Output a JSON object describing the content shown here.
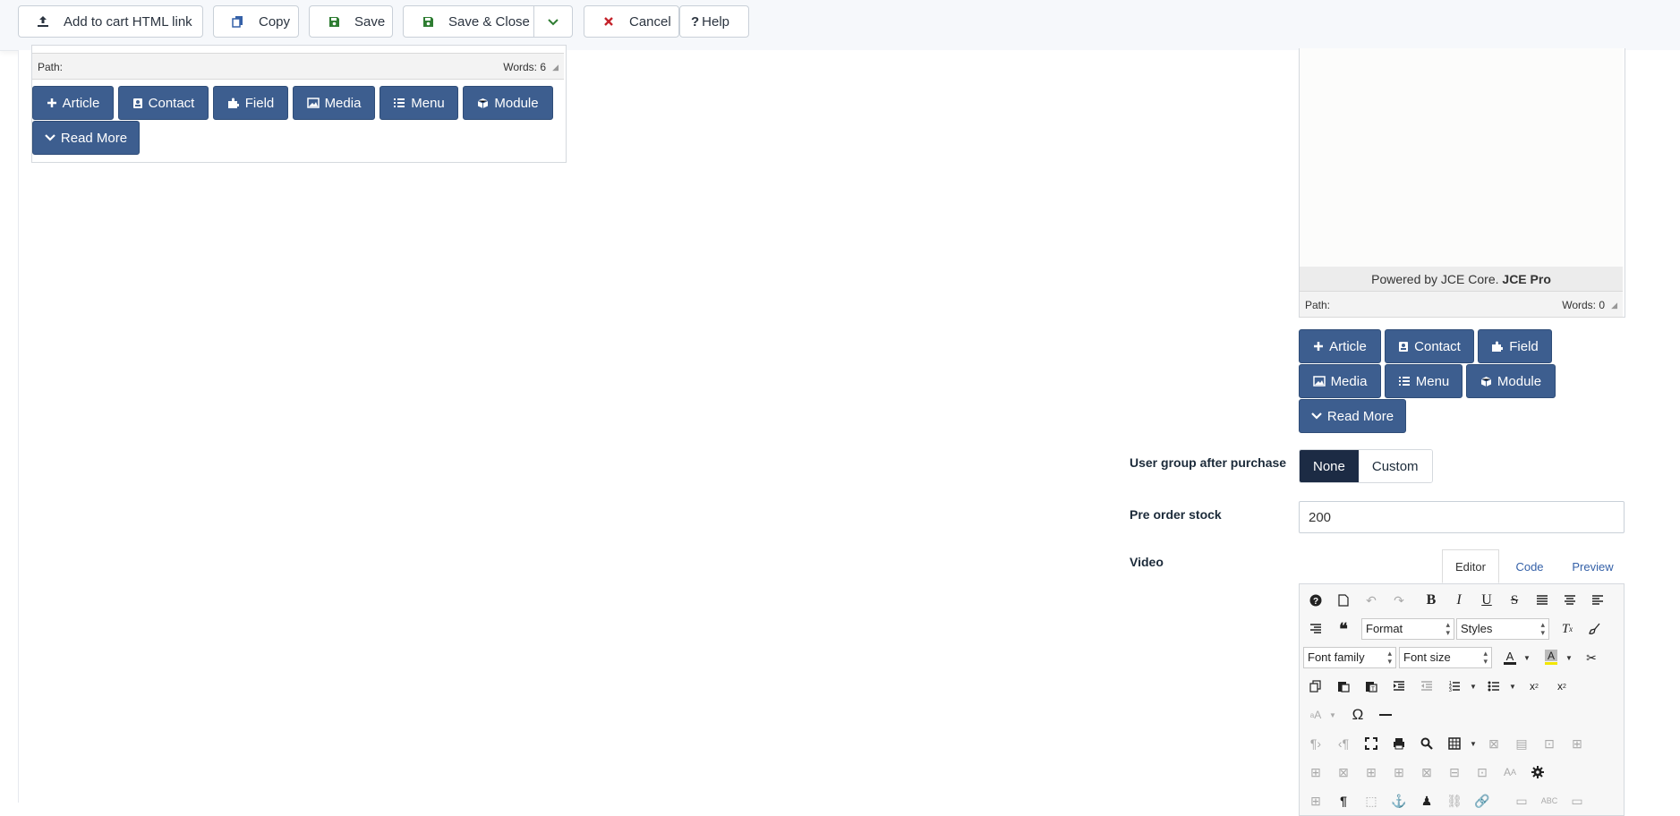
{
  "toolbar": {
    "add_to_cart": "Add to cart HTML link",
    "copy": "Copy",
    "save": "Save",
    "save_close": "Save & Close",
    "cancel": "Cancel",
    "help": "Help"
  },
  "left_editor": {
    "path_label": "Path:",
    "words": "Words: 6",
    "buttons": [
      "Article",
      "Contact",
      "Field",
      "Media",
      "Menu",
      "Module",
      "Read More"
    ]
  },
  "right_editor": {
    "powered_prefix": "Powered by JCE Core.",
    "powered_bold": "JCE Pro",
    "path_label": "Path:",
    "words": "Words: 0",
    "buttons": [
      "Article",
      "Contact",
      "Field",
      "Media",
      "Menu",
      "Module",
      "Read More"
    ]
  },
  "user_group": {
    "label": "User group after purchase",
    "options": [
      "None",
      "Custom"
    ],
    "selected": "None"
  },
  "pre_order": {
    "label": "Pre order stock",
    "value": "200"
  },
  "video": {
    "label": "Video",
    "tabs": [
      "Editor",
      "Code",
      "Preview"
    ],
    "active_tab": "Editor",
    "format_select": "Format",
    "styles_select": "Styles",
    "font_family_select": "Font family",
    "font_size_select": "Font size"
  },
  "colors": {
    "accent_button": "#3d5e8f",
    "segment_active": "#1c2b44",
    "cancel_icon": "#c4232b",
    "save_icon": "#2e7d32"
  }
}
